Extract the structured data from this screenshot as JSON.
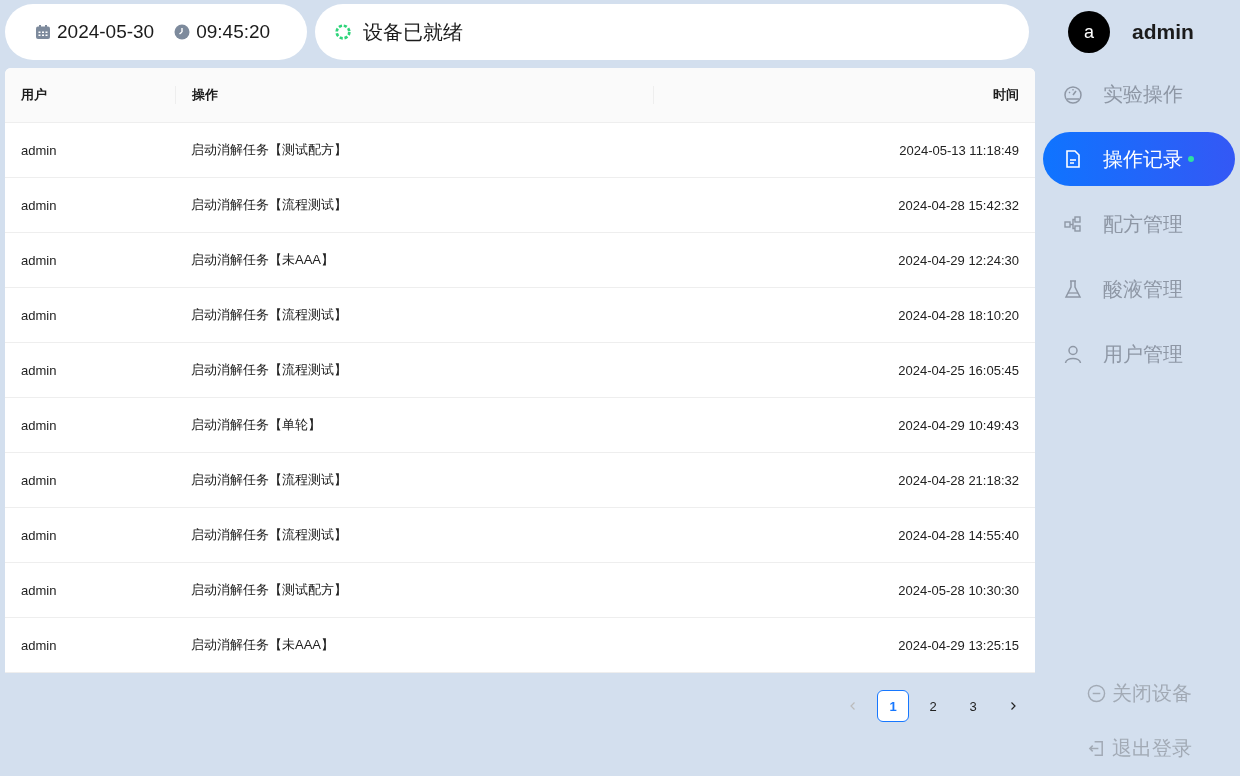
{
  "header": {
    "date": "2024-05-30",
    "time": "09:45:20",
    "status": "设备已就绪"
  },
  "user": {
    "avatar_letter": "a",
    "name": "admin"
  },
  "table": {
    "columns": [
      "用户",
      "操作",
      "时间"
    ],
    "rows": [
      {
        "cells": [
          "admin",
          "启动消解任务【测试配方】",
          "2024-05-13 11:18:49"
        ]
      },
      {
        "cells": [
          "admin",
          "启动消解任务【流程测试】",
          "2024-04-28 15:42:32"
        ]
      },
      {
        "cells": [
          "admin",
          "启动消解任务【未AAA】",
          "2024-04-29 12:24:30"
        ]
      },
      {
        "cells": [
          "admin",
          "启动消解任务【流程测试】",
          "2024-04-28 18:10:20"
        ]
      },
      {
        "cells": [
          "admin",
          "启动消解任务【流程测试】",
          "2024-04-25 16:05:45"
        ]
      },
      {
        "cells": [
          "admin",
          "启动消解任务【单轮】",
          "2024-04-29 10:49:43"
        ]
      },
      {
        "cells": [
          "admin",
          "启动消解任务【流程测试】",
          "2024-04-28 21:18:32"
        ]
      },
      {
        "cells": [
          "admin",
          "启动消解任务【流程测试】",
          "2024-04-28 14:55:40"
        ]
      },
      {
        "cells": [
          "admin",
          "启动消解任务【测试配方】",
          "2024-05-28 10:30:30"
        ]
      },
      {
        "cells": [
          "admin",
          "启动消解任务【未AAA】",
          "2024-04-29 13:25:15"
        ]
      }
    ]
  },
  "pagination": {
    "prev_disabled": true,
    "next_disabled": false,
    "pages": [
      {
        "label": "1",
        "selected": true
      },
      {
        "label": "2",
        "selected": false
      },
      {
        "label": "3",
        "selected": false
      }
    ]
  },
  "sidebar": {
    "items": [
      {
        "label": "实验操作",
        "selected": false
      },
      {
        "label": "操作记录",
        "selected": true
      },
      {
        "label": "配方管理",
        "selected": false
      },
      {
        "label": "酸液管理",
        "selected": false
      },
      {
        "label": "用户管理",
        "selected": false
      }
    ],
    "actions": [
      "关闭设备",
      "退出登录"
    ]
  }
}
